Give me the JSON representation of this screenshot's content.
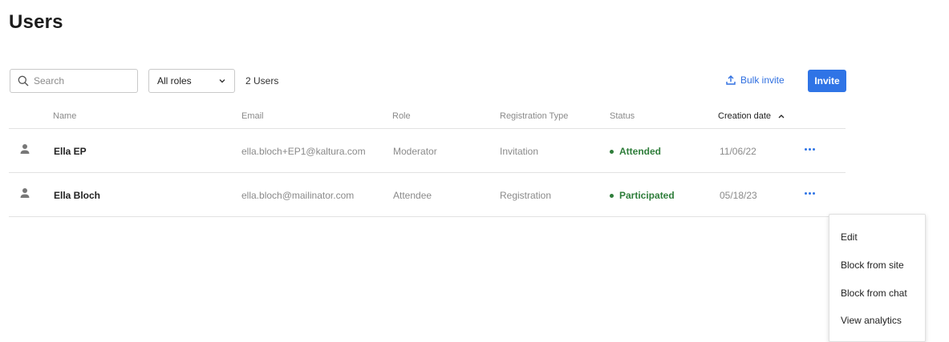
{
  "page": {
    "title": "Users"
  },
  "toolbar": {
    "search_placeholder": "Search",
    "role_filter_value": "All roles",
    "user_count": "2 Users",
    "bulk_invite_label": "Bulk invite",
    "invite_label": "Invite"
  },
  "table": {
    "columns": [
      "Name",
      "Email",
      "Role",
      "Registration Type",
      "Status",
      "Creation date"
    ],
    "sorted_column": "Creation date",
    "sort_direction": "ascending",
    "rows": [
      {
        "name": "Ella EP",
        "email": "ella.bloch+EP1@kaltura.com",
        "role": "Moderator",
        "registration_type": "Invitation",
        "status": "Attended",
        "creation_date": "11/06/22"
      },
      {
        "name": "Ella Bloch",
        "email": "ella.bloch@mailinator.com",
        "role": "Attendee",
        "registration_type": "Registration",
        "status": "Participated",
        "creation_date": "05/18/23"
      }
    ]
  },
  "row_menu": {
    "items": [
      "Edit",
      "Block from site",
      "Block from chat",
      "View analytics"
    ]
  },
  "icons": {
    "search": "search-icon",
    "chevron": "chevron-down-icon",
    "upload": "upload-icon",
    "sort": "chevron-up-icon",
    "user": "user-icon",
    "more": "more-horizontal-icon"
  },
  "colors": {
    "accent": "#2f74e6",
    "status_success": "#2e7d3a",
    "muted_text": "#8a8a8a"
  }
}
